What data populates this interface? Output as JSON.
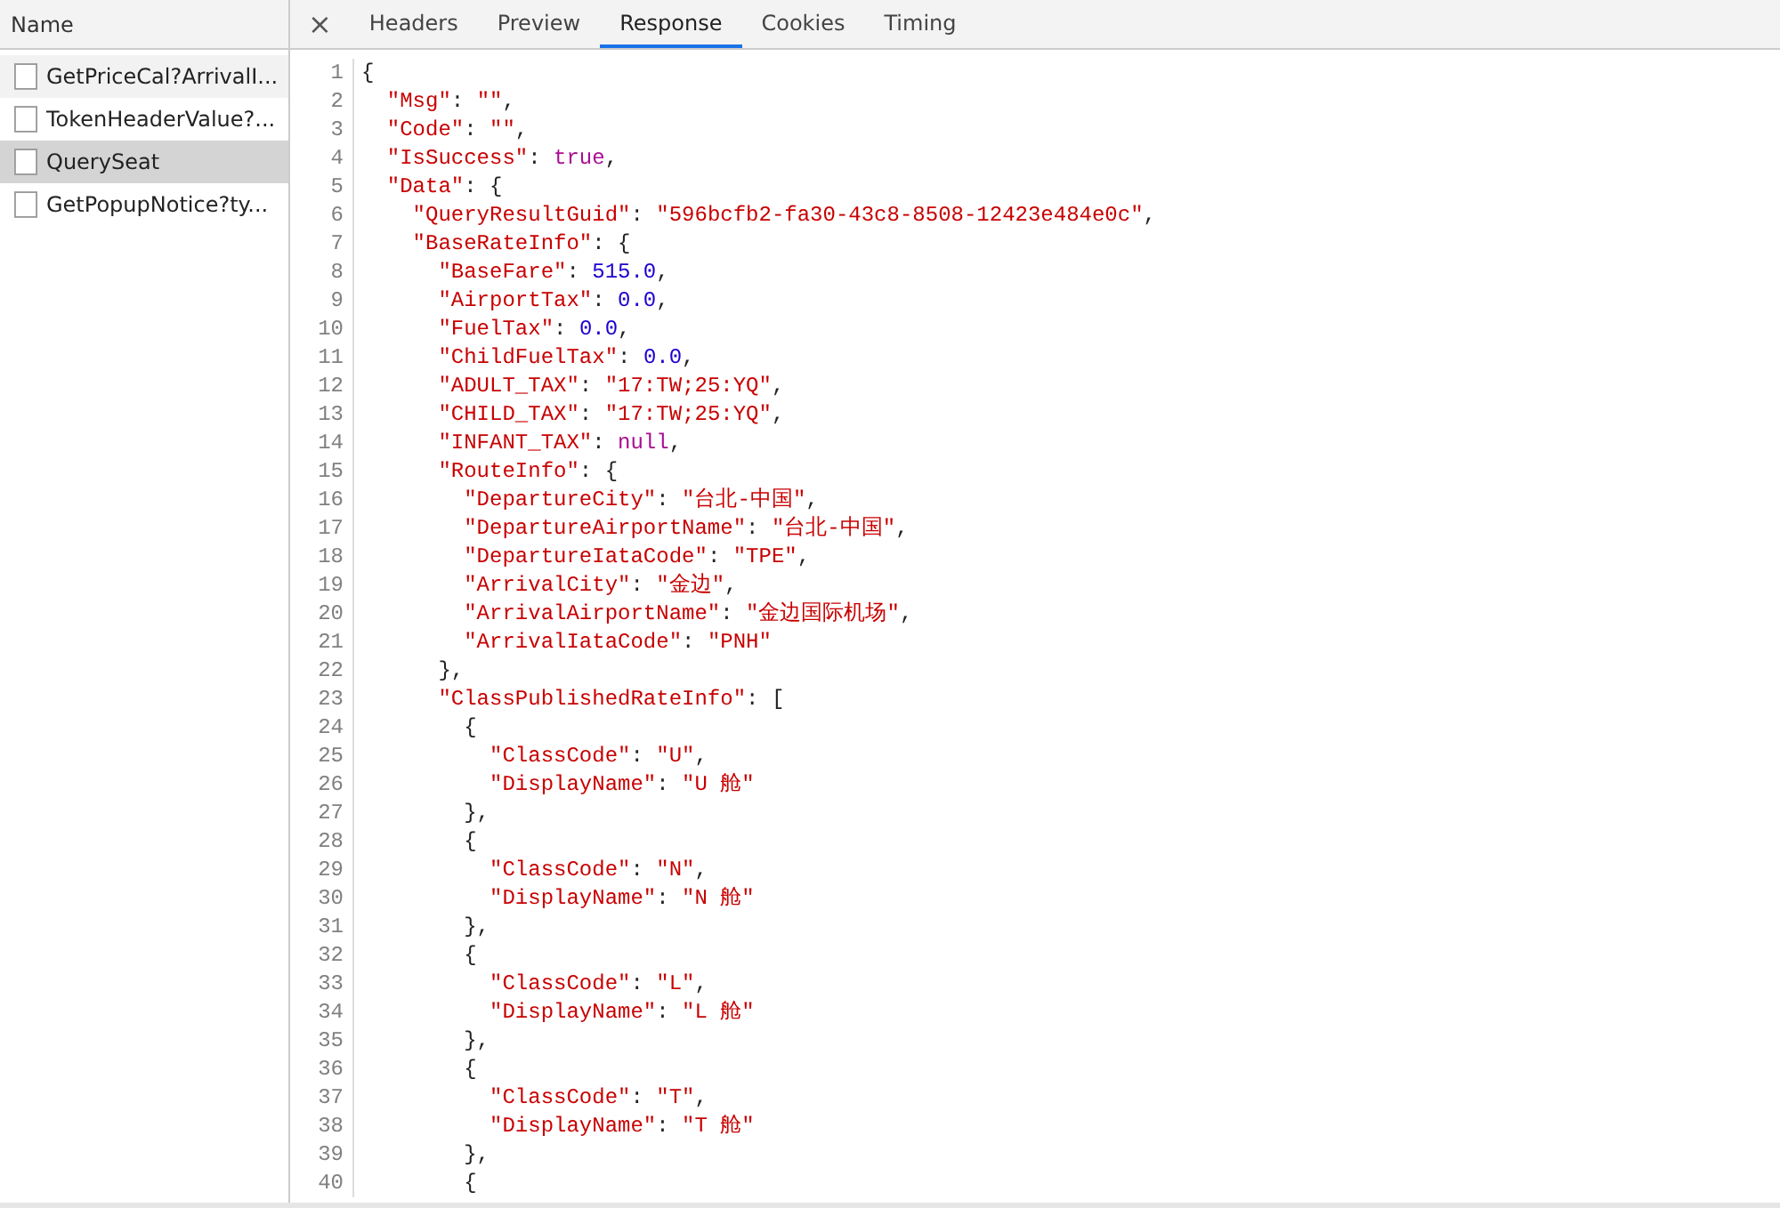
{
  "requests": {
    "header": "Name",
    "items": [
      {
        "name": "GetPriceCal?ArrivalI...",
        "selected": false,
        "hovered": true
      },
      {
        "name": "TokenHeaderValue?...",
        "selected": false,
        "hovered": false
      },
      {
        "name": "QuerySeat",
        "selected": true,
        "hovered": false
      },
      {
        "name": "GetPopupNotice?ty...",
        "selected": false,
        "hovered": false
      }
    ]
  },
  "tabs": {
    "close": "×",
    "items": [
      {
        "label": "Headers",
        "selected": false
      },
      {
        "label": "Preview",
        "selected": false
      },
      {
        "label": "Response",
        "selected": true
      },
      {
        "label": "Cookies",
        "selected": false
      },
      {
        "label": "Timing",
        "selected": false
      }
    ]
  },
  "response": {
    "lines": [
      {
        "number": "1",
        "tokens": [
          {
            "kind": "punct",
            "text": "{"
          }
        ]
      },
      {
        "number": "2",
        "tokens": [
          {
            "kind": "key",
            "text": "  \"Msg\""
          },
          {
            "kind": "punct",
            "text": ": "
          },
          {
            "kind": "string",
            "text": "\"\""
          },
          {
            "kind": "punct",
            "text": ","
          }
        ]
      },
      {
        "number": "3",
        "tokens": [
          {
            "kind": "key",
            "text": "  \"Code\""
          },
          {
            "kind": "punct",
            "text": ": "
          },
          {
            "kind": "string",
            "text": "\"\""
          },
          {
            "kind": "punct",
            "text": ","
          }
        ]
      },
      {
        "number": "4",
        "tokens": [
          {
            "kind": "key",
            "text": "  \"IsSuccess\""
          },
          {
            "kind": "punct",
            "text": ": "
          },
          {
            "kind": "literal",
            "text": "true"
          },
          {
            "kind": "punct",
            "text": ","
          }
        ]
      },
      {
        "number": "5",
        "tokens": [
          {
            "kind": "key",
            "text": "  \"Data\""
          },
          {
            "kind": "punct",
            "text": ": {"
          }
        ]
      },
      {
        "number": "6",
        "tokens": [
          {
            "kind": "key",
            "text": "    \"QueryResultGuid\""
          },
          {
            "kind": "punct",
            "text": ": "
          },
          {
            "kind": "string",
            "text": "\"596bcfb2-fa30-43c8-8508-12423e484e0c\""
          },
          {
            "kind": "punct",
            "text": ","
          }
        ]
      },
      {
        "number": "7",
        "tokens": [
          {
            "kind": "key",
            "text": "    \"BaseRateInfo\""
          },
          {
            "kind": "punct",
            "text": ": {"
          }
        ]
      },
      {
        "number": "8",
        "tokens": [
          {
            "kind": "key",
            "text": "      \"BaseFare\""
          },
          {
            "kind": "punct",
            "text": ": "
          },
          {
            "kind": "number",
            "text": "515.0"
          },
          {
            "kind": "punct",
            "text": ","
          }
        ]
      },
      {
        "number": "9",
        "tokens": [
          {
            "kind": "key",
            "text": "      \"AirportTax\""
          },
          {
            "kind": "punct",
            "text": ": "
          },
          {
            "kind": "number",
            "text": "0.0"
          },
          {
            "kind": "punct",
            "text": ","
          }
        ]
      },
      {
        "number": "10",
        "tokens": [
          {
            "kind": "key",
            "text": "      \"FuelTax\""
          },
          {
            "kind": "punct",
            "text": ": "
          },
          {
            "kind": "number",
            "text": "0.0"
          },
          {
            "kind": "punct",
            "text": ","
          }
        ]
      },
      {
        "number": "11",
        "tokens": [
          {
            "kind": "key",
            "text": "      \"ChildFuelTax\""
          },
          {
            "kind": "punct",
            "text": ": "
          },
          {
            "kind": "number",
            "text": "0.0"
          },
          {
            "kind": "punct",
            "text": ","
          }
        ]
      },
      {
        "number": "12",
        "tokens": [
          {
            "kind": "key",
            "text": "      \"ADULT_TAX\""
          },
          {
            "kind": "punct",
            "text": ": "
          },
          {
            "kind": "string",
            "text": "\"17:TW;25:YQ\""
          },
          {
            "kind": "punct",
            "text": ","
          }
        ]
      },
      {
        "number": "13",
        "tokens": [
          {
            "kind": "key",
            "text": "      \"CHILD_TAX\""
          },
          {
            "kind": "punct",
            "text": ": "
          },
          {
            "kind": "string",
            "text": "\"17:TW;25:YQ\""
          },
          {
            "kind": "punct",
            "text": ","
          }
        ]
      },
      {
        "number": "14",
        "tokens": [
          {
            "kind": "key",
            "text": "      \"INFANT_TAX\""
          },
          {
            "kind": "punct",
            "text": ": "
          },
          {
            "kind": "literal",
            "text": "null"
          },
          {
            "kind": "punct",
            "text": ","
          }
        ]
      },
      {
        "number": "15",
        "tokens": [
          {
            "kind": "key",
            "text": "      \"RouteInfo\""
          },
          {
            "kind": "punct",
            "text": ": {"
          }
        ]
      },
      {
        "number": "16",
        "tokens": [
          {
            "kind": "key",
            "text": "        \"DepartureCity\""
          },
          {
            "kind": "punct",
            "text": ": "
          },
          {
            "kind": "string",
            "text": "\"台北-中国\""
          },
          {
            "kind": "punct",
            "text": ","
          }
        ]
      },
      {
        "number": "17",
        "tokens": [
          {
            "kind": "key",
            "text": "        \"DepartureAirportName\""
          },
          {
            "kind": "punct",
            "text": ": "
          },
          {
            "kind": "string",
            "text": "\"台北-中国\""
          },
          {
            "kind": "punct",
            "text": ","
          }
        ]
      },
      {
        "number": "18",
        "tokens": [
          {
            "kind": "key",
            "text": "        \"DepartureIataCode\""
          },
          {
            "kind": "punct",
            "text": ": "
          },
          {
            "kind": "string",
            "text": "\"TPE\""
          },
          {
            "kind": "punct",
            "text": ","
          }
        ]
      },
      {
        "number": "19",
        "tokens": [
          {
            "kind": "key",
            "text": "        \"ArrivalCity\""
          },
          {
            "kind": "punct",
            "text": ": "
          },
          {
            "kind": "string",
            "text": "\"金边\""
          },
          {
            "kind": "punct",
            "text": ","
          }
        ]
      },
      {
        "number": "20",
        "tokens": [
          {
            "kind": "key",
            "text": "        \"ArrivalAirportName\""
          },
          {
            "kind": "punct",
            "text": ": "
          },
          {
            "kind": "string",
            "text": "\"金边国际机场\""
          },
          {
            "kind": "punct",
            "text": ","
          }
        ]
      },
      {
        "number": "21",
        "tokens": [
          {
            "kind": "key",
            "text": "        \"ArrivalIataCode\""
          },
          {
            "kind": "punct",
            "text": ": "
          },
          {
            "kind": "string",
            "text": "\"PNH\""
          }
        ]
      },
      {
        "number": "22",
        "tokens": [
          {
            "kind": "punct",
            "text": "      },"
          }
        ]
      },
      {
        "number": "23",
        "tokens": [
          {
            "kind": "key",
            "text": "      \"ClassPublishedRateInfo\""
          },
          {
            "kind": "punct",
            "text": ": ["
          }
        ]
      },
      {
        "number": "24",
        "tokens": [
          {
            "kind": "punct",
            "text": "        {"
          }
        ]
      },
      {
        "number": "25",
        "tokens": [
          {
            "kind": "key",
            "text": "          \"ClassCode\""
          },
          {
            "kind": "punct",
            "text": ": "
          },
          {
            "kind": "string",
            "text": "\"U\""
          },
          {
            "kind": "punct",
            "text": ","
          }
        ]
      },
      {
        "number": "26",
        "tokens": [
          {
            "kind": "key",
            "text": "          \"DisplayName\""
          },
          {
            "kind": "punct",
            "text": ": "
          },
          {
            "kind": "string",
            "text": "\"U 舱\""
          }
        ]
      },
      {
        "number": "27",
        "tokens": [
          {
            "kind": "punct",
            "text": "        },"
          }
        ]
      },
      {
        "number": "28",
        "tokens": [
          {
            "kind": "punct",
            "text": "        {"
          }
        ]
      },
      {
        "number": "29",
        "tokens": [
          {
            "kind": "key",
            "text": "          \"ClassCode\""
          },
          {
            "kind": "punct",
            "text": ": "
          },
          {
            "kind": "string",
            "text": "\"N\""
          },
          {
            "kind": "punct",
            "text": ","
          }
        ]
      },
      {
        "number": "30",
        "tokens": [
          {
            "kind": "key",
            "text": "          \"DisplayName\""
          },
          {
            "kind": "punct",
            "text": ": "
          },
          {
            "kind": "string",
            "text": "\"N 舱\""
          }
        ]
      },
      {
        "number": "31",
        "tokens": [
          {
            "kind": "punct",
            "text": "        },"
          }
        ]
      },
      {
        "number": "32",
        "tokens": [
          {
            "kind": "punct",
            "text": "        {"
          }
        ]
      },
      {
        "number": "33",
        "tokens": [
          {
            "kind": "key",
            "text": "          \"ClassCode\""
          },
          {
            "kind": "punct",
            "text": ": "
          },
          {
            "kind": "string",
            "text": "\"L\""
          },
          {
            "kind": "punct",
            "text": ","
          }
        ]
      },
      {
        "number": "34",
        "tokens": [
          {
            "kind": "key",
            "text": "          \"DisplayName\""
          },
          {
            "kind": "punct",
            "text": ": "
          },
          {
            "kind": "string",
            "text": "\"L 舱\""
          }
        ]
      },
      {
        "number": "35",
        "tokens": [
          {
            "kind": "punct",
            "text": "        },"
          }
        ]
      },
      {
        "number": "36",
        "tokens": [
          {
            "kind": "punct",
            "text": "        {"
          }
        ]
      },
      {
        "number": "37",
        "tokens": [
          {
            "kind": "key",
            "text": "          \"ClassCode\""
          },
          {
            "kind": "punct",
            "text": ": "
          },
          {
            "kind": "string",
            "text": "\"T\""
          },
          {
            "kind": "punct",
            "text": ","
          }
        ]
      },
      {
        "number": "38",
        "tokens": [
          {
            "kind": "key",
            "text": "          \"DisplayName\""
          },
          {
            "kind": "punct",
            "text": ": "
          },
          {
            "kind": "string",
            "text": "\"T 舱\""
          }
        ]
      },
      {
        "number": "39",
        "tokens": [
          {
            "kind": "punct",
            "text": "        },"
          }
        ]
      },
      {
        "number": "40",
        "tokens": [
          {
            "kind": "punct",
            "text": "        {"
          }
        ]
      }
    ]
  }
}
